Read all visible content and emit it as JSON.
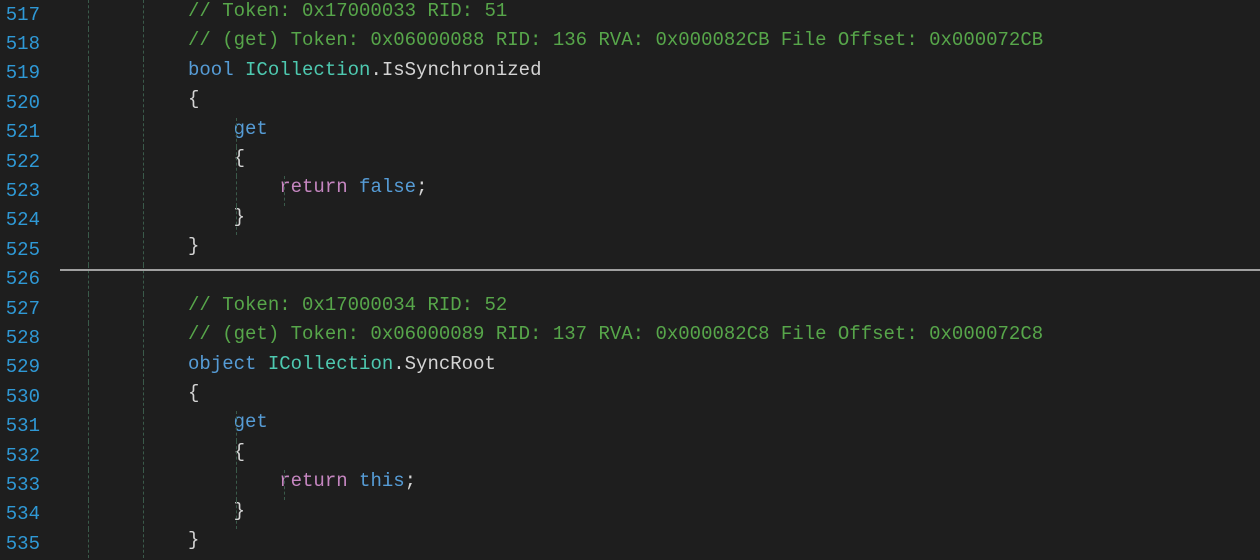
{
  "lines": [
    {
      "num": "517",
      "depth": 0,
      "tokens": [
        {
          "cls": "comment",
          "t": "// Token: 0x17000033 RID: 51"
        }
      ]
    },
    {
      "num": "518",
      "depth": 0,
      "tokens": [
        {
          "cls": "comment",
          "t": "// (get) Token: 0x06000088 RID: 136 RVA: 0x000082CB File Offset: 0x000072CB"
        }
      ]
    },
    {
      "num": "519",
      "depth": 0,
      "tokens": [
        {
          "cls": "kw-type",
          "t": "bool"
        },
        {
          "cls": "punct",
          "t": " "
        },
        {
          "cls": "type",
          "t": "ICollection"
        },
        {
          "cls": "punct",
          "t": "."
        },
        {
          "cls": "member",
          "t": "IsSynchronized"
        }
      ]
    },
    {
      "num": "520",
      "depth": 0,
      "tokens": [
        {
          "cls": "punct",
          "t": "{"
        }
      ]
    },
    {
      "num": "521",
      "depth": 1,
      "tokens": [
        {
          "cls": "kw-type",
          "t": "    get"
        }
      ]
    },
    {
      "num": "522",
      "depth": 1,
      "tokens": [
        {
          "cls": "punct",
          "t": "    {"
        }
      ]
    },
    {
      "num": "523",
      "depth": 2,
      "tokens": [
        {
          "cls": "punct",
          "t": "        "
        },
        {
          "cls": "kw-flow",
          "t": "return"
        },
        {
          "cls": "punct",
          "t": " "
        },
        {
          "cls": "kw-lit",
          "t": "false"
        },
        {
          "cls": "punct",
          "t": ";"
        }
      ]
    },
    {
      "num": "524",
      "depth": 1,
      "tokens": [
        {
          "cls": "punct",
          "t": "    }"
        }
      ]
    },
    {
      "num": "525",
      "depth": 0,
      "tokens": [
        {
          "cls": "punct",
          "t": "}"
        }
      ]
    },
    {
      "num": "526",
      "depth": 0,
      "tokens": []
    },
    {
      "num": "527",
      "depth": 0,
      "tokens": [
        {
          "cls": "comment",
          "t": "// Token: 0x17000034 RID: 52"
        }
      ]
    },
    {
      "num": "528",
      "depth": 0,
      "tokens": [
        {
          "cls": "comment",
          "t": "// (get) Token: 0x06000089 RID: 137 RVA: 0x000082C8 File Offset: 0x000072C8"
        }
      ]
    },
    {
      "num": "529",
      "depth": 0,
      "tokens": [
        {
          "cls": "kw-type",
          "t": "object"
        },
        {
          "cls": "punct",
          "t": " "
        },
        {
          "cls": "type",
          "t": "ICollection"
        },
        {
          "cls": "punct",
          "t": "."
        },
        {
          "cls": "member",
          "t": "SyncRoot"
        }
      ]
    },
    {
      "num": "530",
      "depth": 0,
      "tokens": [
        {
          "cls": "punct",
          "t": "{"
        }
      ]
    },
    {
      "num": "531",
      "depth": 1,
      "tokens": [
        {
          "cls": "kw-type",
          "t": "    get"
        }
      ]
    },
    {
      "num": "532",
      "depth": 1,
      "tokens": [
        {
          "cls": "punct",
          "t": "    {"
        }
      ]
    },
    {
      "num": "533",
      "depth": 2,
      "tokens": [
        {
          "cls": "punct",
          "t": "        "
        },
        {
          "cls": "kw-flow",
          "t": "return"
        },
        {
          "cls": "punct",
          "t": " "
        },
        {
          "cls": "this",
          "t": "this"
        },
        {
          "cls": "punct",
          "t": ";"
        }
      ]
    },
    {
      "num": "534",
      "depth": 1,
      "tokens": [
        {
          "cls": "punct",
          "t": "    }"
        }
      ]
    },
    {
      "num": "535",
      "depth": 0,
      "tokens": [
        {
          "cls": "punct",
          "t": "}"
        }
      ]
    }
  ]
}
